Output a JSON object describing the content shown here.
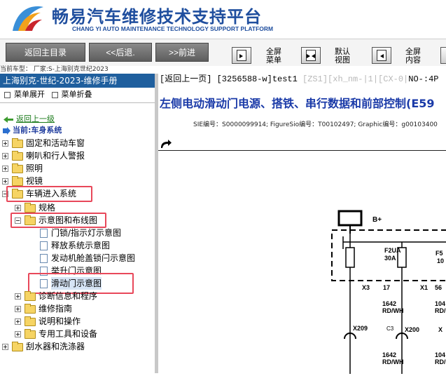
{
  "header": {
    "title_cn": "畅易汽车维修技术支持平台",
    "title_en": "CHANG YI AUTO MAINTENANCE TECHNOLOGY SUPPORT PLATFORM",
    "brand_color": "#1f4e9e"
  },
  "toolbar": {
    "home_label": "返回主目录",
    "back_label": "<<后退.",
    "forward_label": ">>前进",
    "fullscreen_menu_label": [
      "全屏",
      "菜单"
    ],
    "default_view_label": [
      "默认",
      "视图"
    ],
    "fullscreen_content_label": [
      "全屏",
      "内容"
    ]
  },
  "status": {
    "text": "当前车型：   厂家:S-上海别克世纪2023"
  },
  "left_panel": {
    "manual_title": "上海别克-世纪-2023-维修手册",
    "expand_label": "菜单展开",
    "collapse_label": "菜单折叠",
    "back_link": "返回上一级",
    "current_label": "当前:车身系统",
    "tree": [
      {
        "label": "固定和活动车窗",
        "type": "folder",
        "expanded": false
      },
      {
        "label": "喇叭和行人警报",
        "type": "folder",
        "expanded": false
      },
      {
        "label": "照明",
        "type": "folder",
        "expanded": false
      },
      {
        "label": "视镜",
        "type": "folder",
        "expanded": false
      },
      {
        "label": "车辆进入系统",
        "type": "folder",
        "expanded": true
      },
      {
        "label": "规格",
        "type": "folder",
        "expanded": false
      },
      {
        "label": "示意图和布线图",
        "type": "folder",
        "expanded": true
      },
      {
        "label": "门锁/指示灯示意图",
        "type": "doc"
      },
      {
        "label": "释放系统示意图",
        "type": "doc"
      },
      {
        "label": "发动机舱盖锁闩示意图",
        "type": "doc"
      },
      {
        "label": "举升门示意图",
        "type": "doc"
      },
      {
        "label": "滑动门示意图",
        "type": "doc",
        "selected": true
      },
      {
        "label": "诊断信息和程序",
        "type": "folder",
        "expanded": false
      },
      {
        "label": "维修指南",
        "type": "folder",
        "expanded": false
      },
      {
        "label": "说明和操作",
        "type": "folder",
        "expanded": false
      },
      {
        "label": "专用工具和设备",
        "type": "folder",
        "expanded": false
      },
      {
        "label": "刮水器和洗涤器",
        "type": "folder",
        "expanded": false
      }
    ],
    "highlight_color": "#e8485a"
  },
  "right_panel": {
    "nav_prefix": "[返回上一页]",
    "nav_rest": " [3256588-w]test1 ",
    "nav_gray": "[ZS1][xh_nm-|1|[CX-0|",
    "nav_tail": "NO-:4P",
    "doc_title": "左侧电动滑动门电源、搭铁、串行数据和前部控制(E59",
    "sie_line": "SIE编号：S0000099914;  FigureSio编号：T00102497;  Graphic编号：g00103400",
    "title_color": "#1a3aa8"
  },
  "diagram": {
    "battery_label": "B+",
    "fuse1_name": "F2UA",
    "fuse1_rating": "30A",
    "fuse2_name": "F5",
    "fuse2_rating": "10",
    "conn_x3": "X3",
    "conn_x3_pin": "17",
    "conn_x1": "X1",
    "conn_x1_pin": "56",
    "wire1_num": "1642",
    "wire1_color": "RD/WH",
    "wire2_num": "104",
    "wire2_color": "RD/",
    "x209": "X209",
    "x209_pin": "C3",
    "x200": "X200",
    "x_right": "X",
    "wire3_num": "1642",
    "wire3_color": "RD/WH",
    "wire4_num": "104",
    "wire4_color": "RD/"
  }
}
